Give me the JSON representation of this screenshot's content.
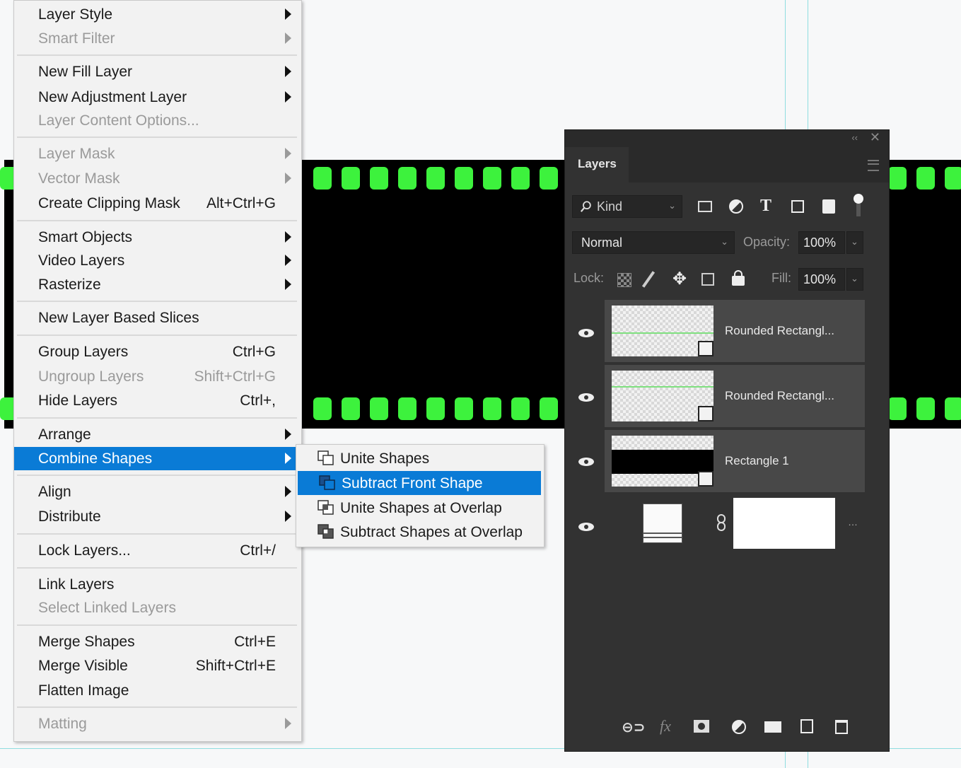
{
  "menu": {
    "items": [
      {
        "label": "Layer Style",
        "shortcut": "",
        "submenu": true,
        "disabled": false
      },
      {
        "label": "Smart Filter",
        "shortcut": "",
        "submenu": true,
        "disabled": true
      },
      {
        "label": "New Fill Layer",
        "shortcut": "",
        "submenu": true,
        "disabled": false
      },
      {
        "label": "New Adjustment Layer",
        "shortcut": "",
        "submenu": true,
        "disabled": false
      },
      {
        "label": "Layer Content Options...",
        "shortcut": "",
        "submenu": false,
        "disabled": true
      },
      {
        "label": "Layer Mask",
        "shortcut": "",
        "submenu": true,
        "disabled": true
      },
      {
        "label": "Vector Mask",
        "shortcut": "",
        "submenu": true,
        "disabled": true
      },
      {
        "label": "Create Clipping Mask",
        "shortcut": "Alt+Ctrl+G",
        "submenu": false,
        "disabled": false
      },
      {
        "label": "Smart Objects",
        "shortcut": "",
        "submenu": true,
        "disabled": false
      },
      {
        "label": "Video Layers",
        "shortcut": "",
        "submenu": true,
        "disabled": false
      },
      {
        "label": "Rasterize",
        "shortcut": "",
        "submenu": true,
        "disabled": false
      },
      {
        "label": "New Layer Based Slices",
        "shortcut": "",
        "submenu": false,
        "disabled": false
      },
      {
        "label": "Group Layers",
        "shortcut": "Ctrl+G",
        "submenu": false,
        "disabled": false
      },
      {
        "label": "Ungroup Layers",
        "shortcut": "Shift+Ctrl+G",
        "submenu": false,
        "disabled": true
      },
      {
        "label": "Hide Layers",
        "shortcut": "Ctrl+,",
        "submenu": false,
        "disabled": false
      },
      {
        "label": "Arrange",
        "shortcut": "",
        "submenu": true,
        "disabled": false
      },
      {
        "label": "Combine Shapes",
        "shortcut": "",
        "submenu": true,
        "disabled": false,
        "highlighted": true
      },
      {
        "label": "Align",
        "shortcut": "",
        "submenu": true,
        "disabled": false
      },
      {
        "label": "Distribute",
        "shortcut": "",
        "submenu": true,
        "disabled": false
      },
      {
        "label": "Lock Layers...",
        "shortcut": "Ctrl+/",
        "submenu": false,
        "disabled": false
      },
      {
        "label": "Link Layers",
        "shortcut": "",
        "submenu": false,
        "disabled": false
      },
      {
        "label": "Select Linked Layers",
        "shortcut": "",
        "submenu": false,
        "disabled": true
      },
      {
        "label": "Merge Shapes",
        "shortcut": "Ctrl+E",
        "submenu": false,
        "disabled": false
      },
      {
        "label": "Merge Visible",
        "shortcut": "Shift+Ctrl+E",
        "submenu": false,
        "disabled": false
      },
      {
        "label": "Flatten Image",
        "shortcut": "",
        "submenu": false,
        "disabled": false
      },
      {
        "label": "Matting",
        "shortcut": "",
        "submenu": true,
        "disabled": true
      }
    ]
  },
  "submenu": {
    "items": [
      {
        "label": "Unite Shapes",
        "icon": "unite-shapes-icon"
      },
      {
        "label": "Subtract Front Shape",
        "icon": "subtract-front-shape-icon",
        "highlighted": true
      },
      {
        "label": "Unite Shapes at Overlap",
        "icon": "intersect-shapes-icon"
      },
      {
        "label": "Subtract Shapes at Overlap",
        "icon": "exclude-overlap-icon"
      }
    ]
  },
  "layers_panel": {
    "tab_label": "Layers",
    "filter_label": "Kind",
    "blend_mode": "Normal",
    "opacity_label": "Opacity:",
    "opacity_value": "100%",
    "lock_label": "Lock:",
    "fill_label": "Fill:",
    "fill_value": "100%",
    "layers": [
      {
        "name": "Rounded Rectangl..."
      },
      {
        "name": "Rounded Rectangl..."
      },
      {
        "name": "Rectangle 1"
      },
      {
        "name": ""
      }
    ]
  },
  "colors": {
    "highlight": "#0a7bd6",
    "film_hole": "#3df23d",
    "panel_bg": "#323232"
  }
}
